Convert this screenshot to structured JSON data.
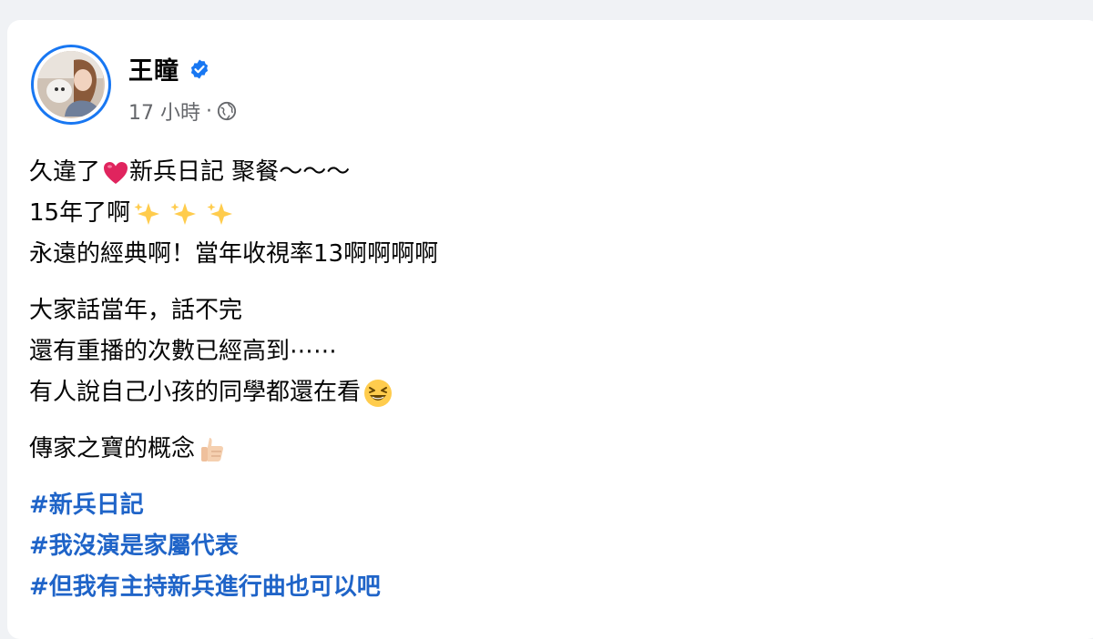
{
  "post": {
    "author": {
      "name": "王瞳",
      "verified": true
    },
    "meta": {
      "time": "17 小時",
      "separator": "·",
      "audience_icon": "globe-icon"
    },
    "paragraphs": [
      {
        "lines": [
          {
            "text": "久違了",
            "emoji": "red-heart",
            "after": "新兵日記 聚餐～～～"
          },
          {
            "text": "15年了啊",
            "emoji": "sparkles-x3"
          },
          {
            "text": "永遠的經典啊！當年收視率13啊啊啊啊"
          }
        ]
      },
      {
        "lines": [
          {
            "text": "大家話當年，話不完"
          },
          {
            "text": "還有重播的次數已經高到⋯⋯"
          },
          {
            "text": "有人說自己小孩的同學都還在看",
            "emoji": "laughing-face"
          }
        ]
      },
      {
        "lines": [
          {
            "text": "傳家之寶的概念",
            "emoji": "thumbs-up"
          }
        ]
      }
    ],
    "hashtags": [
      "#新兵日記",
      "#我沒演是家屬代表",
      "#但我有主持新兵進行曲也可以吧"
    ]
  },
  "colors": {
    "hashtag": "#1f64c8",
    "verified": "#1877f2",
    "meta": "#65676b",
    "background": "#f0f2f5"
  }
}
